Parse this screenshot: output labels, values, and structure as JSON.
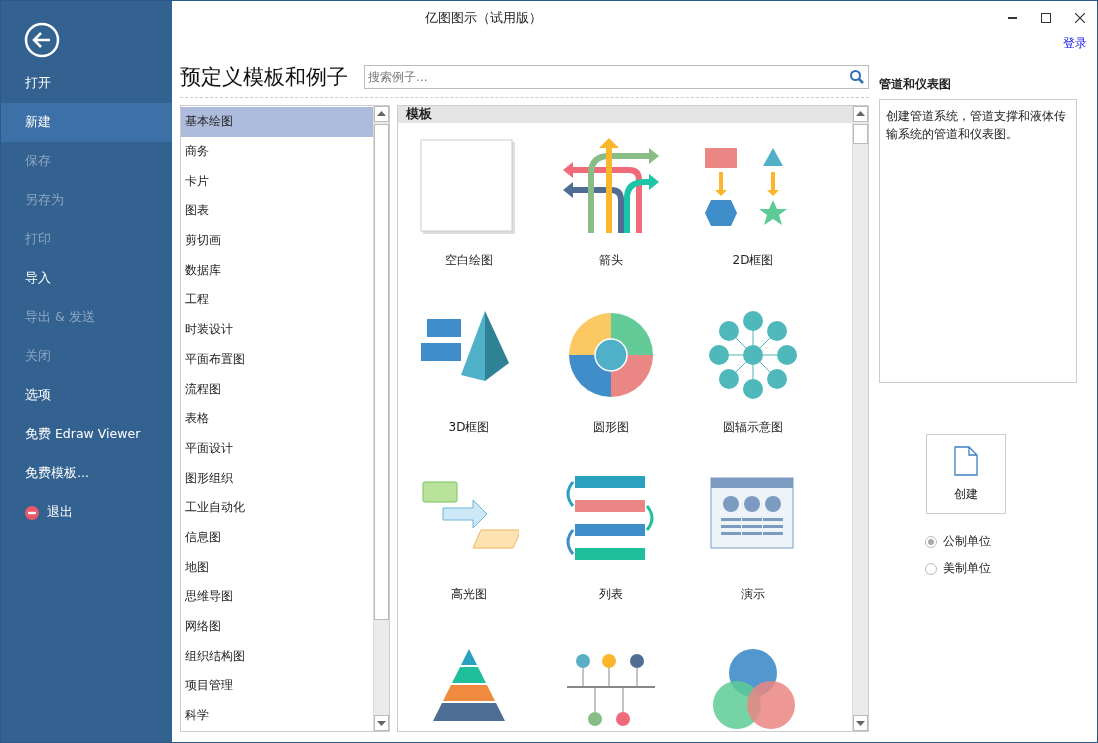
{
  "window": {
    "title": "亿图图示（试用版）",
    "login": "登录"
  },
  "sidebar": {
    "items": [
      {
        "label": "打开",
        "kind": "plain",
        "selected": false,
        "disabled": false
      },
      {
        "label": "新建",
        "kind": "plain",
        "selected": true,
        "disabled": false
      },
      {
        "label": "保存",
        "kind": "plain",
        "selected": false,
        "disabled": true
      },
      {
        "label": "另存为",
        "kind": "plain",
        "selected": false,
        "disabled": true
      },
      {
        "label": "打印",
        "kind": "plain",
        "selected": false,
        "disabled": true
      },
      {
        "label": "导入",
        "kind": "plain",
        "selected": false,
        "disabled": false
      },
      {
        "label": "导出 & 发送",
        "kind": "plain",
        "selected": false,
        "disabled": true
      },
      {
        "label": "关闭",
        "kind": "plain",
        "selected": false,
        "disabled": true
      },
      {
        "label": "选项",
        "kind": "plain",
        "selected": false,
        "disabled": false
      },
      {
        "label": "免费 Edraw Viewer",
        "kind": "plain",
        "selected": false,
        "disabled": false
      },
      {
        "label": "免费模板...",
        "kind": "plain",
        "selected": false,
        "disabled": false
      },
      {
        "label": "退出",
        "kind": "exit",
        "selected": false,
        "disabled": false
      }
    ]
  },
  "heading": "预定义模板和例子",
  "search": {
    "placeholder": "搜索例子..."
  },
  "categories": [
    {
      "label": "基本绘图",
      "selected": true
    },
    {
      "label": "商务",
      "selected": false
    },
    {
      "label": "卡片",
      "selected": false
    },
    {
      "label": "图表",
      "selected": false
    },
    {
      "label": "剪切画",
      "selected": false
    },
    {
      "label": "数据库",
      "selected": false
    },
    {
      "label": "工程",
      "selected": false
    },
    {
      "label": "时装设计",
      "selected": false
    },
    {
      "label": "平面布置图",
      "selected": false
    },
    {
      "label": "流程图",
      "selected": false
    },
    {
      "label": "表格",
      "selected": false
    },
    {
      "label": "平面设计",
      "selected": false
    },
    {
      "label": "图形组织",
      "selected": false
    },
    {
      "label": "工业自动化",
      "selected": false
    },
    {
      "label": "信息图",
      "selected": false
    },
    {
      "label": "地图",
      "selected": false
    },
    {
      "label": "思维导图",
      "selected": false
    },
    {
      "label": "网络图",
      "selected": false
    },
    {
      "label": "组织结构图",
      "selected": false
    },
    {
      "label": "项目管理",
      "selected": false
    },
    {
      "label": "科学",
      "selected": false
    }
  ],
  "templates": {
    "title": "模板",
    "items": [
      {
        "label": "空白绘图",
        "kind": "blank"
      },
      {
        "label": "箭头",
        "kind": "arrows"
      },
      {
        "label": "2D框图",
        "kind": "shapes2d"
      },
      {
        "label": "3D框图",
        "kind": "shapes3d"
      },
      {
        "label": "圆形图",
        "kind": "ring"
      },
      {
        "label": "圆辐示意图",
        "kind": "radial"
      },
      {
        "label": "高光图",
        "kind": "highlight"
      },
      {
        "label": "列表",
        "kind": "list"
      },
      {
        "label": "演示",
        "kind": "slide"
      },
      {
        "kind": "pyramid"
      },
      {
        "kind": "timeline"
      },
      {
        "kind": "venn"
      }
    ]
  },
  "details": {
    "title": "管道和仪表图",
    "description": "创建管道系统，管道支撑和液体传输系统的管道和仪表图。",
    "create": "创建"
  },
  "units": [
    {
      "label": "公制单位",
      "selected": true
    },
    {
      "label": "美制单位",
      "selected": false
    }
  ]
}
